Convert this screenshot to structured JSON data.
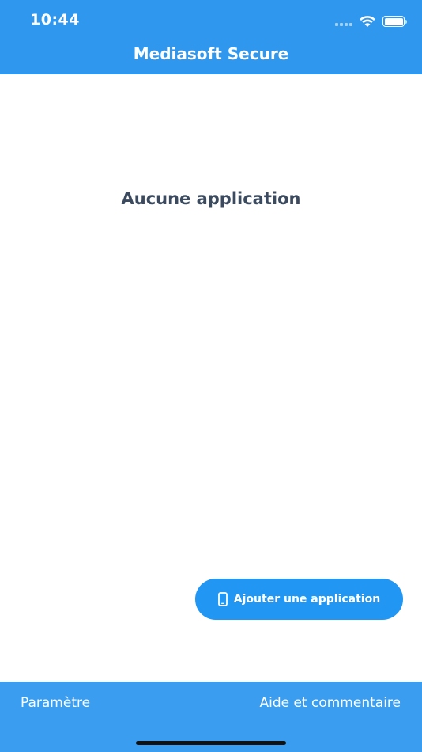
{
  "status_bar": {
    "time": "10:44",
    "signal_icon": "signal-icon",
    "wifi_icon": "wifi-icon",
    "battery_icon": "battery-icon"
  },
  "header": {
    "title": "Mediasoft Secure"
  },
  "main": {
    "empty_message": "Aucune application"
  },
  "add_button": {
    "label": "Ajouter une application",
    "icon": "phone-icon"
  },
  "footer": {
    "settings_label": "Paramètre",
    "help_label": "Aide et commentaire"
  },
  "colors": {
    "header": "#2f97ee",
    "button": "#2196f3",
    "footer": "#3a9df0",
    "message_text": "#3b4a5e"
  }
}
